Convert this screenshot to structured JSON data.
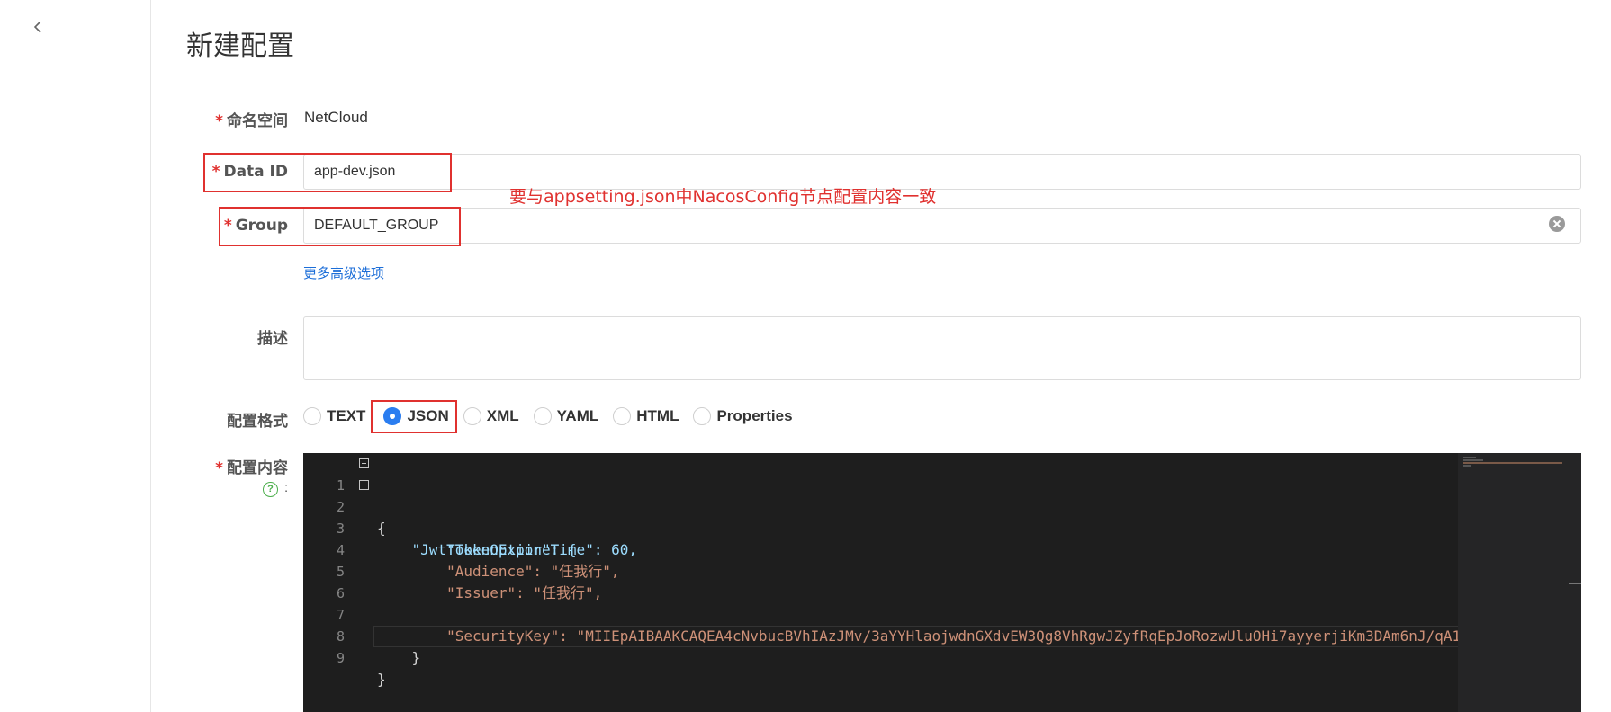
{
  "header": {
    "title": "新建配置"
  },
  "form": {
    "namespace": {
      "label": "命名空间",
      "value": "NetCloud"
    },
    "data_id": {
      "label": "Data ID",
      "value": "app-dev.json"
    },
    "group": {
      "label": "Group",
      "value": "DEFAULT_GROUP"
    },
    "advanced_link": "更多高级选项",
    "description": {
      "label": "描述",
      "value": ""
    },
    "format": {
      "label": "配置格式",
      "options": [
        "TEXT",
        "JSON",
        "XML",
        "YAML",
        "HTML",
        "Properties"
      ],
      "selected": "JSON"
    },
    "content": {
      "label": "配置内容",
      "colon": ":",
      "lines": [
        "{",
        "    \"JwtTokenOption\": {",
        "        \"TokenExpireTime\": 60,",
        "        \"Audience\": \"任我行\",",
        "        \"Issuer\": \"任我行\",",
        "",
        "        \"SecurityKey\": \"MIIEpAIBAAKCAQEA4cNvbucBVhIAzJMv/3aYYHlaojwdnGXdvEW3Qg8VhRgwJZyfRqEpJoRozwUluOHi7ayyerjiKm3DAm6nJ/qA1",
        "    }",
        "}"
      ]
    }
  },
  "annotation": "要与appsetting.json中NacosConfig节点配置内容一致",
  "colors": {
    "accent": "#2a7df0",
    "highlight": "#e0312f",
    "link": "#1c6ed8",
    "editor_bg": "#1e1e1e"
  },
  "icons": {
    "back": "chevron-left-icon",
    "clear": "clear-circle-icon",
    "help": "help-circle-icon"
  }
}
